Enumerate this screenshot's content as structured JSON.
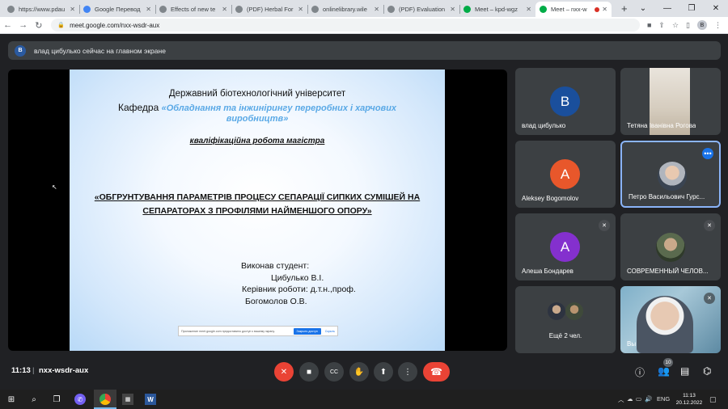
{
  "browser": {
    "tabs": [
      {
        "title": "https://www.pdau",
        "icon": "globe-icon"
      },
      {
        "title": "Google Перевод",
        "icon": "google-translate-icon"
      },
      {
        "title": "Effects of new te",
        "icon": "globe-icon"
      },
      {
        "title": "(PDF) Herbal For",
        "icon": "researchgate-icon"
      },
      {
        "title": "onlinelibrary.wile",
        "icon": "globe-icon"
      },
      {
        "title": "(PDF) Evaluation",
        "icon": "researchgate-icon"
      },
      {
        "title": "Meet – kpd-wgz",
        "icon": "meet-icon"
      },
      {
        "title": "Meet – nxx-w",
        "icon": "meet-icon",
        "active": true
      }
    ],
    "new_tab": "+",
    "url": "meet.google.com/nxx-wsdr-aux",
    "profile_initial": "B"
  },
  "banner": {
    "avatar_initial": "В",
    "text": "влад цибулько сейчас на главном экране"
  },
  "slide": {
    "university": "Державний біотехнологічний університет",
    "dept_prefix": "Кафедра",
    "dept_name_line1": "«Обладнання та інжинірингу переробних і харчових",
    "dept_name_line2": "виробництв»",
    "work_type": "кваліфікаційна робота магістра",
    "theme": "«ОБГРУНТУВАННЯ ПАРАМЕТРІВ ПРОЦЕСУ СЕПАРАЦІЇ СИПКИХ СУМІШЕЙ НА СЕПАРАТОРАХ З ПРОФІЛЯМИ НАЙМЕНШОГО ОПОРУ»",
    "student_label": "Виконав студент:",
    "student_name": "Цибулько В.І.",
    "supervisor_label": "Керівник роботи: д.т.н.,проф.",
    "supervisor_name": "Богомолов О.В.",
    "share_bar": {
      "text": "Приложение meet.google.com предоставило доступ к вашему экрану.",
      "stop_label": "Закрыть доступ",
      "hide_label": "Скрыть"
    }
  },
  "participants": [
    {
      "name": "влад цибулько",
      "initial": "В",
      "color": "#1a4f9c"
    },
    {
      "name": "Тетяна Іванівна Рогова",
      "photo": true
    },
    {
      "name": "Aleksey Bogomolov",
      "initial": "A",
      "color": "#e8572b"
    },
    {
      "name": "Петро Васильович Гурс...",
      "photo": true,
      "speaking": true
    },
    {
      "name": "Алеша Бондарев",
      "initial": "А",
      "color": "#8430ce",
      "muted": true
    },
    {
      "name": "СОВРЕМЕННЫЙ ЧЕЛОВ...",
      "photo": true,
      "muted": true
    },
    {
      "name": "Ещё 2 чел."
    },
    {
      "name": "Вы",
      "self": true,
      "muted": true
    }
  ],
  "bottom_bar": {
    "time": "11:13",
    "separator": "|",
    "meeting_code": "nxx-wsdr-aux",
    "people_count": "10"
  },
  "taskbar": {
    "language": "ENG",
    "time": "11:13",
    "date": "20.12.2022"
  },
  "colors": {
    "meet_bg": "#202124",
    "tile_bg": "#3c4043",
    "end_call": "#ea4335",
    "accent": "#1a73e8"
  }
}
